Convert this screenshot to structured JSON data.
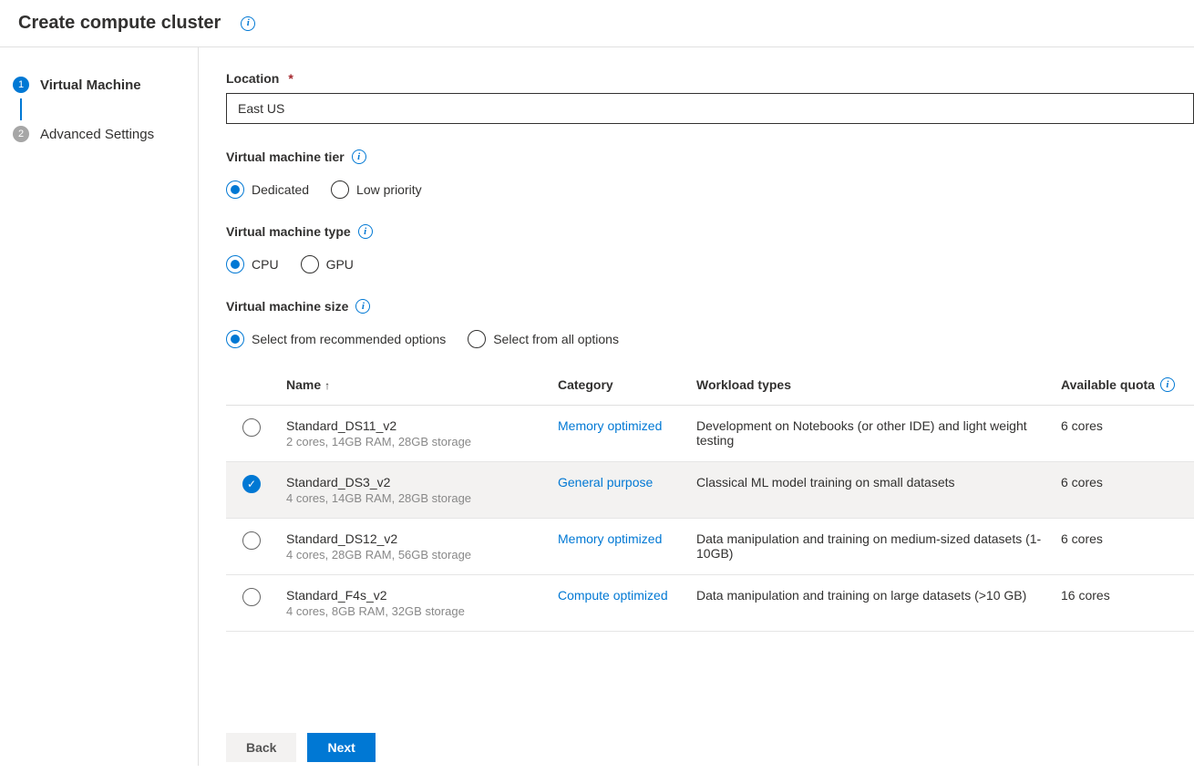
{
  "header": {
    "title": "Create compute cluster"
  },
  "sidebar": {
    "steps": [
      {
        "num": "1",
        "label": "Virtual Machine",
        "active": true
      },
      {
        "num": "2",
        "label": "Advanced Settings",
        "active": false
      }
    ]
  },
  "location": {
    "label": "Location",
    "value": "East US"
  },
  "tier": {
    "label": "Virtual machine tier",
    "options": [
      {
        "label": "Dedicated",
        "selected": true
      },
      {
        "label": "Low priority",
        "selected": false
      }
    ]
  },
  "vmtype": {
    "label": "Virtual machine type",
    "options": [
      {
        "label": "CPU",
        "selected": true
      },
      {
        "label": "GPU",
        "selected": false
      }
    ]
  },
  "vmsize": {
    "label": "Virtual machine size",
    "options": [
      {
        "label": "Select from recommended options",
        "selected": true
      },
      {
        "label": "Select from all options",
        "selected": false
      }
    ]
  },
  "table": {
    "headers": {
      "name": "Name",
      "category": "Category",
      "workload": "Workload types",
      "quota": "Available quota"
    },
    "rows": [
      {
        "name": "Standard_DS11_v2",
        "spec": "2 cores, 14GB RAM, 28GB storage",
        "category": "Memory optimized",
        "workload": "Development on Notebooks (or other IDE) and light weight testing",
        "quota": "6 cores",
        "selected": false
      },
      {
        "name": "Standard_DS3_v2",
        "spec": "4 cores, 14GB RAM, 28GB storage",
        "category": "General purpose",
        "workload": "Classical ML model training on small datasets",
        "quota": "6 cores",
        "selected": true
      },
      {
        "name": "Standard_DS12_v2",
        "spec": "4 cores, 28GB RAM, 56GB storage",
        "category": "Memory optimized",
        "workload": "Data manipulation and training on medium-sized datasets (1-10GB)",
        "quota": "6 cores",
        "selected": false
      },
      {
        "name": "Standard_F4s_v2",
        "spec": "4 cores, 8GB RAM, 32GB storage",
        "category": "Compute optimized",
        "workload": "Data manipulation and training on large datasets (>10 GB)",
        "quota": "16 cores",
        "selected": false
      }
    ]
  },
  "footer": {
    "back": "Back",
    "next": "Next"
  }
}
